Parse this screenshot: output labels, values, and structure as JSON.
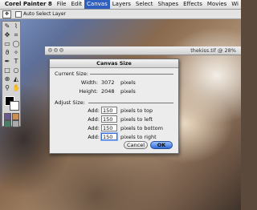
{
  "menubar": {
    "apple_icon": "apple-icon",
    "items": [
      "Corel Painter 8",
      "File",
      "Edit",
      "Canvas",
      "Layers",
      "Select",
      "Shapes",
      "Effects",
      "Movies",
      "Wi"
    ],
    "active_index": 3
  },
  "propbar": {
    "auto_select_label": "Auto Select Layer"
  },
  "document": {
    "title": "thekiss.tif @ 28%"
  },
  "dialog": {
    "title": "Canvas Size",
    "current_size_label": "Current Size:",
    "width_label": "Width:",
    "width_value": "3072",
    "width_unit": "pixels",
    "height_label": "Height:",
    "height_value": "2048",
    "height_unit": "pixels",
    "adjust_size_label": "Adjust Size:",
    "rows": [
      {
        "label": "Add:",
        "value": "150",
        "unit": "pixels to top"
      },
      {
        "label": "Add:",
        "value": "150",
        "unit": "pixels to left"
      },
      {
        "label": "Add:",
        "value": "150",
        "unit": "pixels to bottom"
      },
      {
        "label": "Add:",
        "value": "150",
        "unit": "pixels to right"
      }
    ],
    "cancel_label": "Cancel",
    "ok_label": "OK"
  },
  "colors": {
    "menu_highlight": "#2f5fbf",
    "ok_button": "#2e6bd8"
  }
}
